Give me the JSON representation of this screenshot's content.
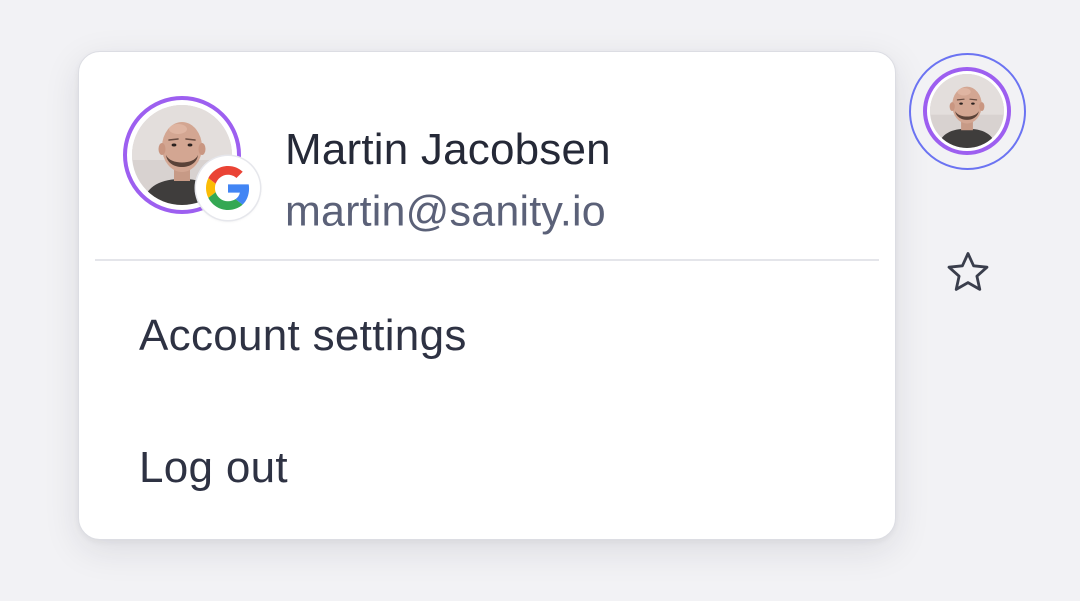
{
  "user": {
    "name": "Martin Jacobsen",
    "email": "martin@sanity.io",
    "avatar_ring_color": "#9d5ff0",
    "auth_provider_icon": "google-icon"
  },
  "menu": {
    "items": [
      {
        "label": "Account settings"
      },
      {
        "label": "Log out"
      }
    ]
  },
  "rail": {
    "avatar_focus_ring_color": "#6b73f2",
    "icons": [
      "user-avatar",
      "star-icon"
    ]
  }
}
